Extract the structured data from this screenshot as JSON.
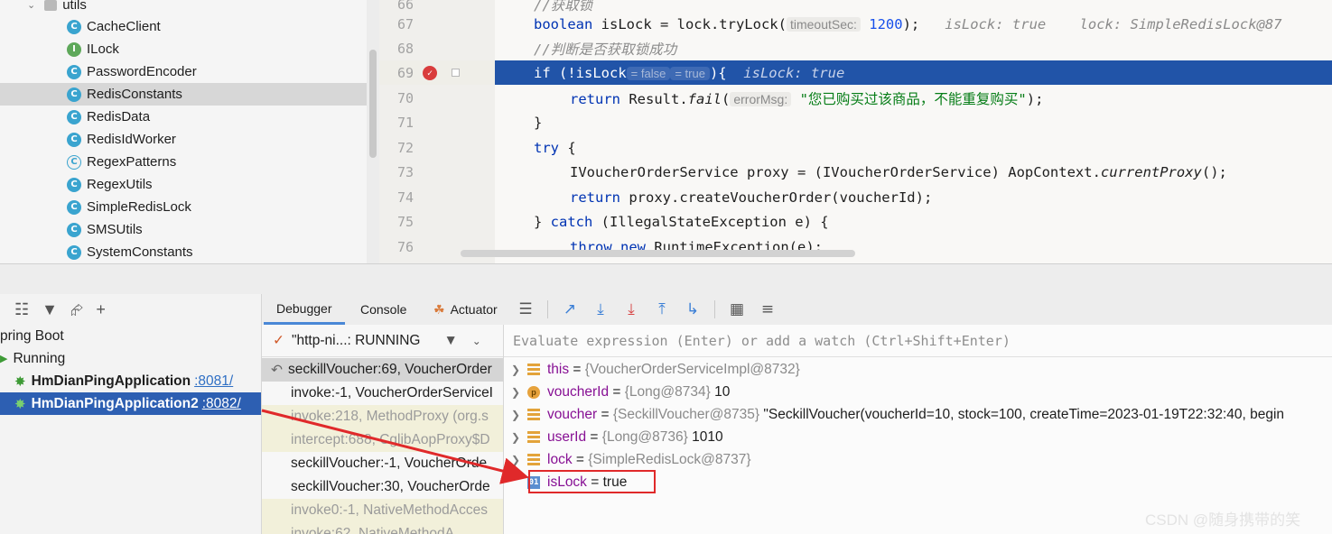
{
  "tree": {
    "root": "utils",
    "items": [
      {
        "label": "CacheClient",
        "icon": "class-icon"
      },
      {
        "label": "ILock",
        "icon": "interface-icon"
      },
      {
        "label": "PasswordEncoder",
        "icon": "class-icon"
      },
      {
        "label": "RedisConstants",
        "icon": "class-icon"
      },
      {
        "label": "RedisData",
        "icon": "class-icon"
      },
      {
        "label": "RedisIdWorker",
        "icon": "class-icon"
      },
      {
        "label": "RegexPatterns",
        "icon": "class-icon"
      },
      {
        "label": "RegexUtils",
        "icon": "class-icon"
      },
      {
        "label": "SimpleRedisLock",
        "icon": "class-icon"
      },
      {
        "label": "SMSUtils",
        "icon": "class-icon"
      },
      {
        "label": "SystemConstants",
        "icon": "class-icon"
      }
    ],
    "selected": "RedisConstants"
  },
  "editor": {
    "lines": {
      "l66": {
        "num": "66",
        "comment": "//获取锁"
      },
      "l67": {
        "num": "67",
        "kw": "boolean",
        "pre": " isLock = lock.tryLock(",
        "hint": "timeoutSec:",
        "val": "1200",
        "post": ");",
        "inline": "   isLock: true    lock: SimpleRedisLock@87"
      },
      "l68": {
        "num": "68",
        "comment": "//判断是否获取锁成功"
      },
      "l69": {
        "num": "69",
        "kw": "if",
        "pre": " (!isLock",
        "chip1": "= false",
        "chip2": "= true",
        "post": "){",
        "inline": "  isLock: true"
      },
      "l70": {
        "num": "70",
        "kw": "return",
        "pre": " Result.",
        "method": "fail",
        "paren": "(",
        "hint": "errorMsg:",
        "str": "\"您已购买过该商品，不能重复购买\"",
        "post": ");"
      },
      "l71": {
        "num": "71",
        "text": "}"
      },
      "l72": {
        "num": "72",
        "kw": "try",
        "post": " {"
      },
      "l73": {
        "num": "73",
        "pre": "IVoucherOrderService proxy = (IVoucherOrderService) AopContext.",
        "method": "currentProxy",
        "post": "();"
      },
      "l74": {
        "num": "74",
        "kw": "return",
        "post": " proxy.createVoucherOrder(voucherId);"
      },
      "l75": {
        "num": "75",
        "pre": "} ",
        "kw": "catch",
        "post": " (IllegalStateException e) {"
      },
      "l76": {
        "num": "76",
        "kw": "throw",
        "kw2": "new",
        "post": " RuntimeException(e);"
      }
    }
  },
  "services": {
    "root_label": "pring Boot",
    "running_label": "Running",
    "apps": [
      {
        "name": "HmDianPingApplication",
        "port": ":8081/"
      },
      {
        "name": "HmDianPingApplication2",
        "port": ":8082/"
      }
    ]
  },
  "debugger": {
    "tabs": [
      "Debugger",
      "Console",
      "Actuator"
    ],
    "thread": "\"http-ni...: RUNNING",
    "frames": [
      "seckillVoucher:69, VoucherOrder",
      "invoke:-1, VoucherOrderServiceI",
      "invoke:218, MethodProxy (org.s",
      "intercept:688, CglibAopProxy$D",
      "seckillVoucher:-1, VoucherOrde",
      "seckillVoucher:30, VoucherOrde",
      "invoke0:-1, NativeMethodAcces",
      "invoke:62, NativeMethodA"
    ],
    "eval_placeholder": "Evaluate expression (Enter) or add a watch (Ctrl+Shift+Enter)",
    "variables": [
      {
        "name": "this",
        "type": "{VoucherOrderServiceImpl@8732}",
        "value": ""
      },
      {
        "name": "voucherId",
        "type": "{Long@8734}",
        "value": "10"
      },
      {
        "name": "voucher",
        "type": "{SeckillVoucher@8735}",
        "value": "\"SeckillVoucher(voucherId=10, stock=100, createTime=2023-01-19T22:32:40, begin"
      },
      {
        "name": "userId",
        "type": "{Long@8736}",
        "value": "1010"
      },
      {
        "name": "lock",
        "type": "{SimpleRedisLock@8737}",
        "value": ""
      },
      {
        "name": "isLock",
        "type": "",
        "value": "true"
      }
    ]
  },
  "watermark": "CSDN @随身携带的笑",
  "colors": {
    "highlight": "#e0292a",
    "exec_line": "#2154a8",
    "selection": "#2d5fb2"
  }
}
